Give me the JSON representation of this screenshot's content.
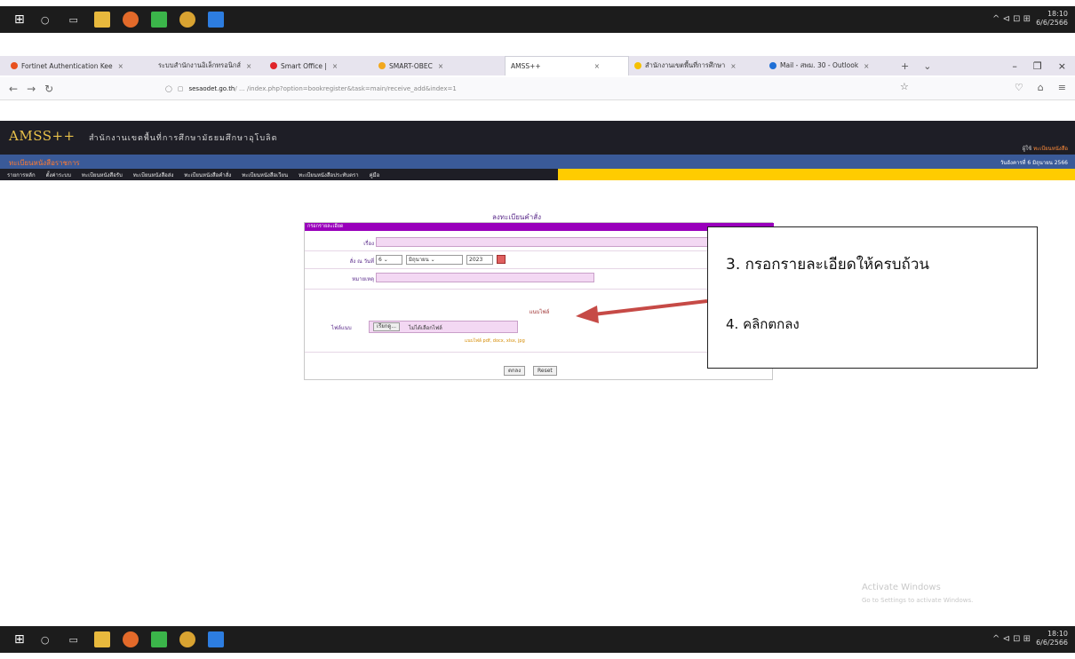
{
  "taskbar": {
    "clock_time": "18:10",
    "clock_date": "6/6/2566",
    "tray": "^ ⊲ ⊡ ⊞"
  },
  "browser": {
    "tabs": [
      {
        "label": "Fortinet Authentication Kee",
        "color": "#e8501e"
      },
      {
        "label": "ระบบสำนักงานอิเล็กทรอนิกส์",
        "color": "#7a7a7a"
      },
      {
        "label": "Smart Office | ",
        "color": "#e0242a"
      },
      {
        "label": "SMART-OBEC",
        "color": "#f2a81d"
      },
      {
        "label": "AMSS++",
        "color": "#9a9a9a"
      },
      {
        "label": "สำนักงานเขตพื้นที่การศึกษา",
        "color": "#f5c000"
      },
      {
        "label": "Mail - สพม. 30 - Outlook",
        "color": "#1f6fd6"
      }
    ],
    "url_domain": "sesaodet.go.th",
    "url_path": "/ ... /index.php?option=bookregister&task=main/receive_add&index=1"
  },
  "amss": {
    "logo": "AMSS++",
    "org": "สำนักงานเขตพื้นที่การศึกษามัธยมศึกษาอุโบลิต",
    "user": "ผู้ใช้",
    "user_role": "ทะเบียนหนังสือ",
    "subheader": "ทะเบียนหนังสือราชการ",
    "date": "วันอังคารที่ 6 มิถุนายน 2566",
    "menu": [
      "รายการหลัก",
      "ตั้งค่าระบบ",
      "ทะเบียนหนังสือรับ",
      "ทะเบียนหนังสือส่ง",
      "ทะเบียนหนังสือคำสั่ง",
      "ทะเบียนหนังสือเวียน",
      "ทะเบียนหนังสือประทับตรา",
      "คู่มือ"
    ]
  },
  "form": {
    "title": "ลงทะเบียนคำสั่ง",
    "bar": "กรอกรายละเอียด",
    "subject_label": "เรื่อง",
    "date_label": "สั่ง ณ วันที่",
    "day": "6",
    "month": "มิถุนายน",
    "year": "2023",
    "note_label": "หมายเหตุ",
    "attach_label": "แนบไฟล์",
    "file_label": "ไฟล์แนบ",
    "browse": "เรียกดู...",
    "nofile": "ไม่ได้เลือกไฟล์",
    "hint": "แนบไฟล์ pdf, docx, xlsx, jpg",
    "ok": "ตกลง",
    "reset": "Reset"
  },
  "annotation": {
    "line1": "3. กรอกรายละเอียดให้ครบถ้วน",
    "line2": "4. คลิกตกลง"
  },
  "watermark": {
    "title": "Activate Windows",
    "sub": "Go to Settings to activate Windows."
  }
}
